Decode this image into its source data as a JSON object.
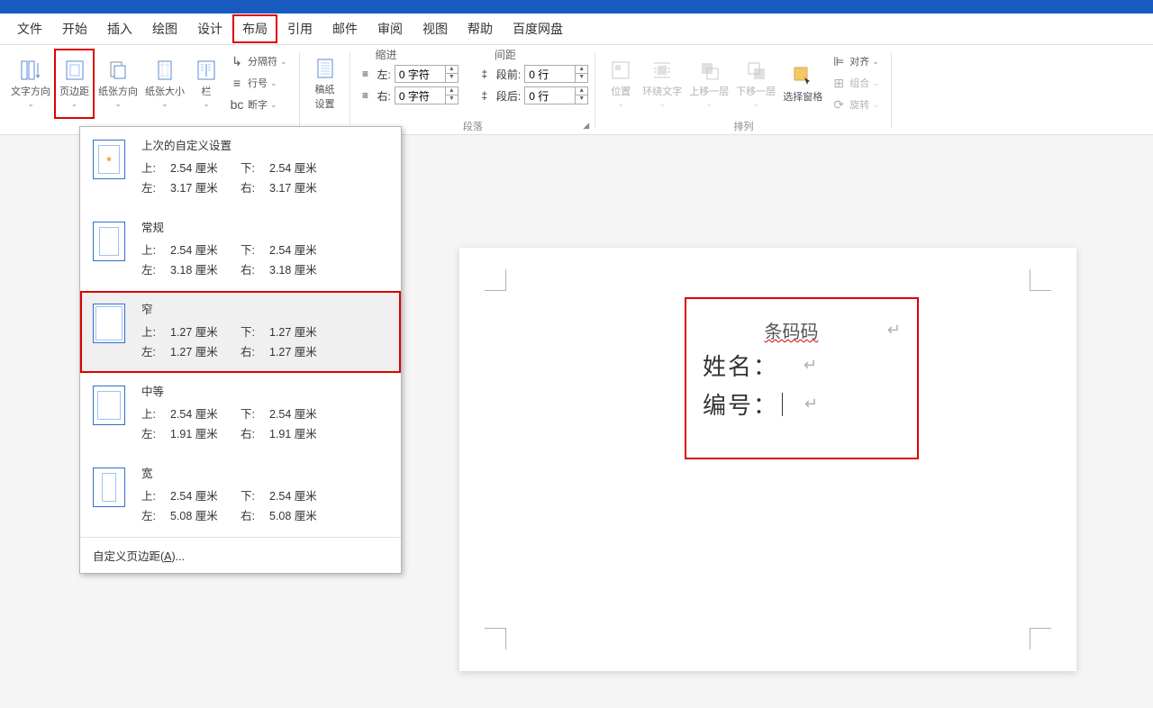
{
  "menu": {
    "file": "文件",
    "home": "开始",
    "insert": "插入",
    "draw": "绘图",
    "design": "设计",
    "layout": "布局",
    "ref": "引用",
    "mail": "邮件",
    "review": "审阅",
    "view": "视图",
    "help": "帮助",
    "baidu": "百度网盘"
  },
  "ribbon": {
    "textdir": "文字方向",
    "margin": "页边距",
    "orient": "纸张方向",
    "size": "纸张大小",
    "columns": "栏",
    "breaks": "分隔符",
    "lineno": "行号",
    "hyphen": "断字",
    "draft": "稿纸",
    "draft2": "设置",
    "indent_lbl": "缩进",
    "indentL": "左:",
    "indentR": "右:",
    "indent_val": "0 字符",
    "spacing_lbl": "间距",
    "spaceB": "段前:",
    "spaceA": "段后:",
    "space_val": "0 行",
    "para_lbl": "段落",
    "pos": "位置",
    "wrap": "环绕文字",
    "fwd": "上移一层",
    "back": "下移一层",
    "pane": "选择窗格",
    "align": "对齐",
    "group": "组合",
    "rotate": "旋转",
    "arrange_lbl": "排列"
  },
  "presets": {
    "last": {
      "title": "上次的自定义设置",
      "top": "2.54 厘米",
      "bottom": "2.54 厘米",
      "left": "3.17 厘米",
      "right": "3.17 厘米"
    },
    "normal": {
      "title": "常规",
      "top": "2.54 厘米",
      "bottom": "2.54 厘米",
      "left": "3.18 厘米",
      "right": "3.18 厘米"
    },
    "narrow": {
      "title": "窄",
      "top": "1.27 厘米",
      "bottom": "1.27 厘米",
      "left": "1.27 厘米",
      "right": "1.27 厘米"
    },
    "moderate": {
      "title": "中等",
      "top": "2.54 厘米",
      "bottom": "2.54 厘米",
      "left": "1.91 厘米",
      "right": "1.91 厘米"
    },
    "wide": {
      "title": "宽",
      "top": "2.54 厘米",
      "bottom": "2.54 厘米",
      "left": "5.08 厘米",
      "right": "5.08 厘米"
    },
    "labels": {
      "top": "上:",
      "bottom": "下:",
      "left": "左:",
      "right": "右:"
    },
    "custom": "自定义页边距(",
    "custom_key": "A",
    "custom_end": ")..."
  },
  "doc": {
    "l1": "条码码",
    "l2": "姓名：",
    "l3": "编号："
  }
}
